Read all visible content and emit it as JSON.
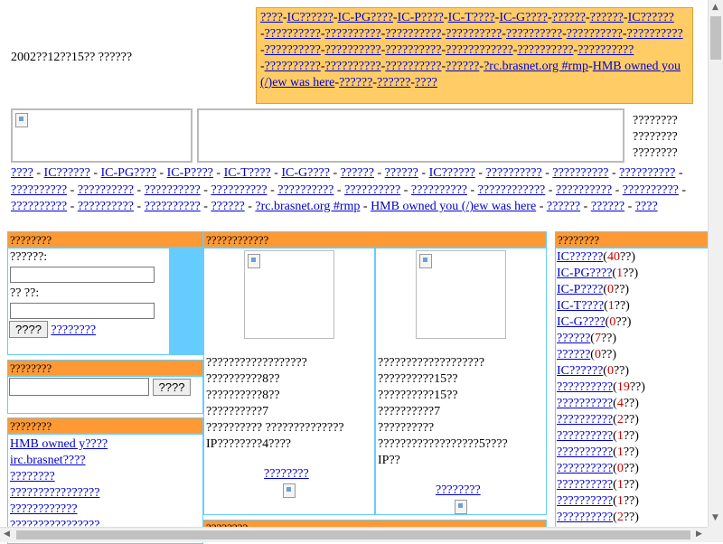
{
  "date_text": "2002??12??15?? ??????",
  "top_nav": [
    "????",
    "IC??????",
    "IC-PG????",
    "IC-P????",
    "IC-T????",
    "IC-G????",
    "??????",
    "??????",
    "IC??????",
    "??????????",
    "??????????",
    "??????????",
    "??????????",
    "??????????",
    "??????????",
    "??????????",
    "??????????",
    "??????????",
    "??????????",
    "????????????",
    "??????????",
    "??????????",
    "??????????",
    "??????????",
    "??????????",
    "??????",
    "?rc.brasnet.org #rmp",
    "HMB owned you (/)ew was here",
    "??????",
    "??????",
    "????"
  ],
  "side_text": [
    "????????",
    "????????",
    "????????"
  ],
  "main_nav": [
    "????",
    "IC??????",
    "IC-PG????",
    "IC-P????",
    "IC-T????",
    "IC-G????",
    "??????",
    "??????",
    "IC??????",
    "??????????",
    "??????????",
    "??????????",
    "??????????",
    "??????????",
    "??????????",
    "??????????",
    "??????????",
    "??????????",
    "??????????",
    "????????????",
    "??????????",
    "??????????",
    "??????????",
    "??????????",
    "??????????",
    "??????",
    "?rc.brasnet.org #rmp",
    "HMB owned you (/)ew was here",
    "??????",
    "??????",
    "????"
  ],
  "login": {
    "title": "????????",
    "user_label": "??????:",
    "pass_label": "??  ??:",
    "submit": "????",
    "register": "????????"
  },
  "search": {
    "title": "????????",
    "button": "????"
  },
  "links_box": {
    "title": "????????",
    "items": [
      "HMB owned y????",
      "irc.brasnet????",
      "????????",
      "????????????????",
      "????????????",
      "????????????????"
    ]
  },
  "center": {
    "title": "????????????",
    "col1": {
      "lines": [
        "??????????????????",
        "??????????8??",
        "??????????8??",
        "??????????7",
        "?????????? ??????????????",
        "IP????????4????"
      ],
      "more": "????????"
    },
    "col2": {
      "lines": [
        "???????????????????",
        "??????????15??",
        "??????????15??",
        "??????????7",
        "??????????",
        "??????????????????5????",
        "IP??"
      ],
      "more": "????????"
    },
    "bottom_title": "????????"
  },
  "right": {
    "title": "????????",
    "items": [
      {
        "label": "IC??????",
        "count": "40",
        "suffix": "??)"
      },
      {
        "label": "IC-PG????",
        "count": "1",
        "suffix": "??)"
      },
      {
        "label": "IC-P????",
        "count": "0",
        "suffix": "??)"
      },
      {
        "label": "IC-T????",
        "count": "1",
        "suffix": "??)"
      },
      {
        "label": "IC-G????",
        "count": "0",
        "suffix": "??)"
      },
      {
        "label": "??????",
        "count": "7",
        "suffix": "??)"
      },
      {
        "label": "??????",
        "count": "0",
        "suffix": "??)"
      },
      {
        "label": "IC??????",
        "count": "0",
        "suffix": "??)"
      },
      {
        "label": "??????????",
        "count": "19",
        "suffix": "??)"
      },
      {
        "label": "??????????",
        "count": "4",
        "suffix": "??)"
      },
      {
        "label": "??????????",
        "count": "2",
        "suffix": "??)"
      },
      {
        "label": "??????????",
        "count": "1",
        "suffix": "??)"
      },
      {
        "label": "??????????",
        "count": "1",
        "suffix": "??)"
      },
      {
        "label": "??????????",
        "count": "0",
        "suffix": "??)"
      },
      {
        "label": "??????????",
        "count": "1",
        "suffix": "??)"
      },
      {
        "label": "??????????",
        "count": "1",
        "suffix": "??)"
      },
      {
        "label": "??????????",
        "count": "2",
        "suffix": "??)"
      }
    ]
  }
}
